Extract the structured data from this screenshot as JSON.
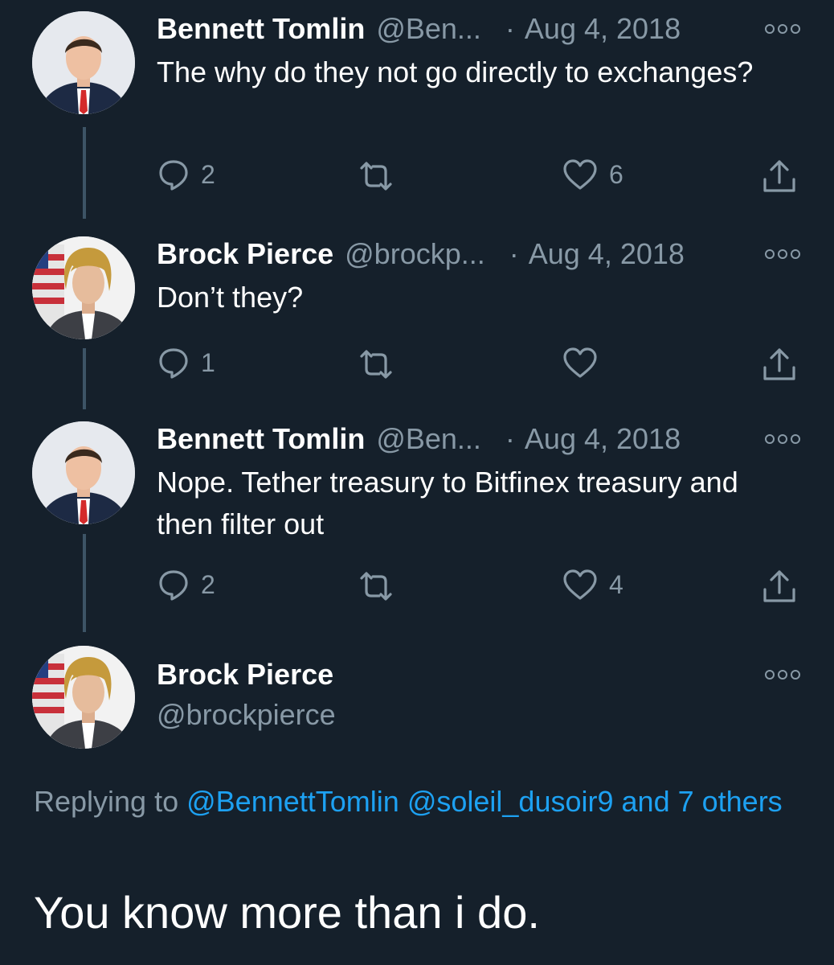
{
  "tweets": [
    {
      "name": "Bennett Tomlin",
      "handle": "@Ben...",
      "dot": "·",
      "date": "Aug 4, 2018",
      "text": "The why do they not go directly to exchanges?",
      "reply_count": "2",
      "retweet_count": "",
      "like_count": "6"
    },
    {
      "name": "Brock Pierce",
      "handle": "@brockp...",
      "dot": "·",
      "date": "Aug 4, 2018",
      "text": "Don’t they?",
      "reply_count": "1",
      "retweet_count": "",
      "like_count": ""
    },
    {
      "name": "Bennett Tomlin",
      "handle": "@Ben...",
      "dot": "·",
      "date": "Aug 4, 2018",
      "text": "Nope. Tether treasury to Bitfinex treasury and then filter out",
      "reply_count": "2",
      "retweet_count": "",
      "like_count": "4"
    }
  ],
  "main_tweet": {
    "name": "Brock Pierce",
    "handle": "@brockpierce",
    "replying_prefix": "Replying to",
    "mention_1": "@BennettTomlin",
    "mention_2": "@soleil_dusoir9",
    "mention_rest": "and 7 others",
    "text": "You know more than i do."
  },
  "colors": {
    "background": "#15202b",
    "text_primary": "#ffffff",
    "text_secondary": "#8899a6",
    "link": "#1da1f2",
    "thread_line": "#3d5466"
  },
  "icons": {
    "reply": "reply-icon",
    "retweet": "retweet-icon",
    "like": "heart-icon",
    "share": "share-icon",
    "more": "more-options-icon"
  }
}
